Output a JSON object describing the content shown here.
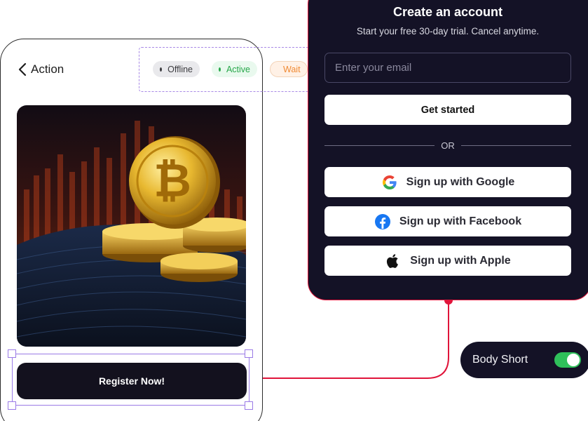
{
  "header": {
    "back_label": "Action"
  },
  "status_chips": [
    {
      "label": "Offline",
      "color": "#3b3b3f"
    },
    {
      "label": "Active",
      "color": "#27a74a"
    },
    {
      "label": "Wait",
      "color": "#f08a33"
    }
  ],
  "register": {
    "label": "Register Now!"
  },
  "signup": {
    "title": "Create an account",
    "subtitle": "Start your free 30-day trial. Cancel anytime.",
    "email_placeholder": "Enter your email",
    "get_started": "Get started",
    "divider": "OR",
    "google": "Sign up with Google",
    "facebook": "Sign up with Facebook",
    "apple": "Sign up with Apple"
  },
  "toggle": {
    "label": "Body Short",
    "state": "on",
    "color": "#2fc05a"
  },
  "colors": {
    "dark": "#141226",
    "connector": "#e0143a",
    "selection": "#9a7ae6"
  }
}
